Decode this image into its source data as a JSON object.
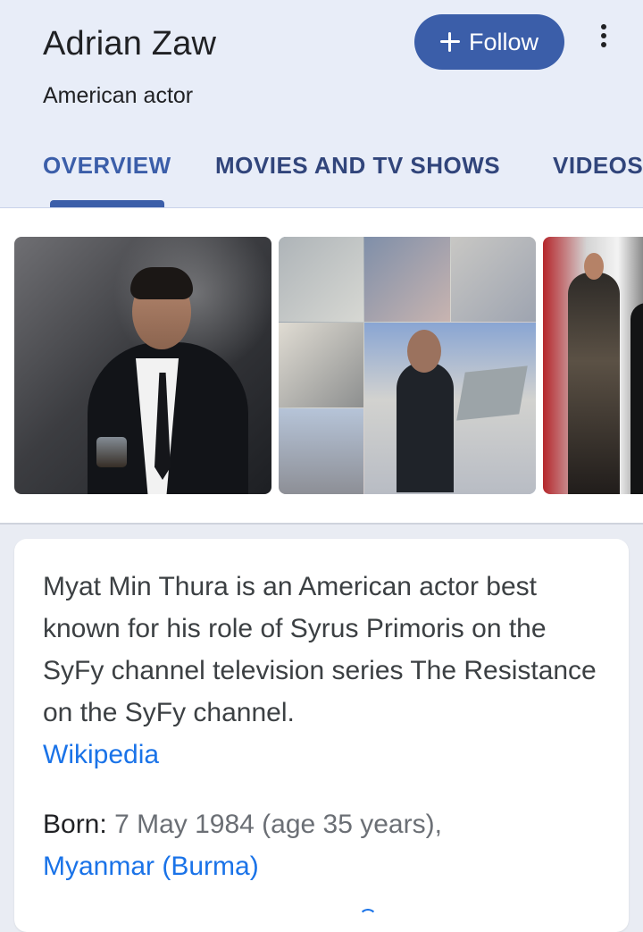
{
  "header": {
    "title": "Adrian Zaw",
    "subtitle": "American actor",
    "follow_label": "Follow"
  },
  "tabs": [
    {
      "label": "OVERVIEW",
      "state": "active"
    },
    {
      "label": "MOVIES AND TV SHOWS",
      "state": "inactive"
    },
    {
      "label": "VIDEOS",
      "state": "inactive"
    }
  ],
  "images": [
    {
      "type": "portrait"
    },
    {
      "type": "collage"
    },
    {
      "type": "event-photo"
    }
  ],
  "knowledge": {
    "description": "Myat Min Thura is an American actor best known for his role of Syrus Primoris on the SyFy channel television series The Resistance on the SyFy channel.",
    "source_link": "Wikipedia",
    "born_label": "Born:",
    "born_value": "7 May 1984 (age 35 years),",
    "born_link": "Myanmar (Burma)"
  },
  "colors": {
    "accent": "#3b5ea9",
    "link": "#1a73e8",
    "header_bg": "#e8edf8"
  },
  "icons": {
    "follow": "plus-icon",
    "more": "more-vert-icon"
  }
}
